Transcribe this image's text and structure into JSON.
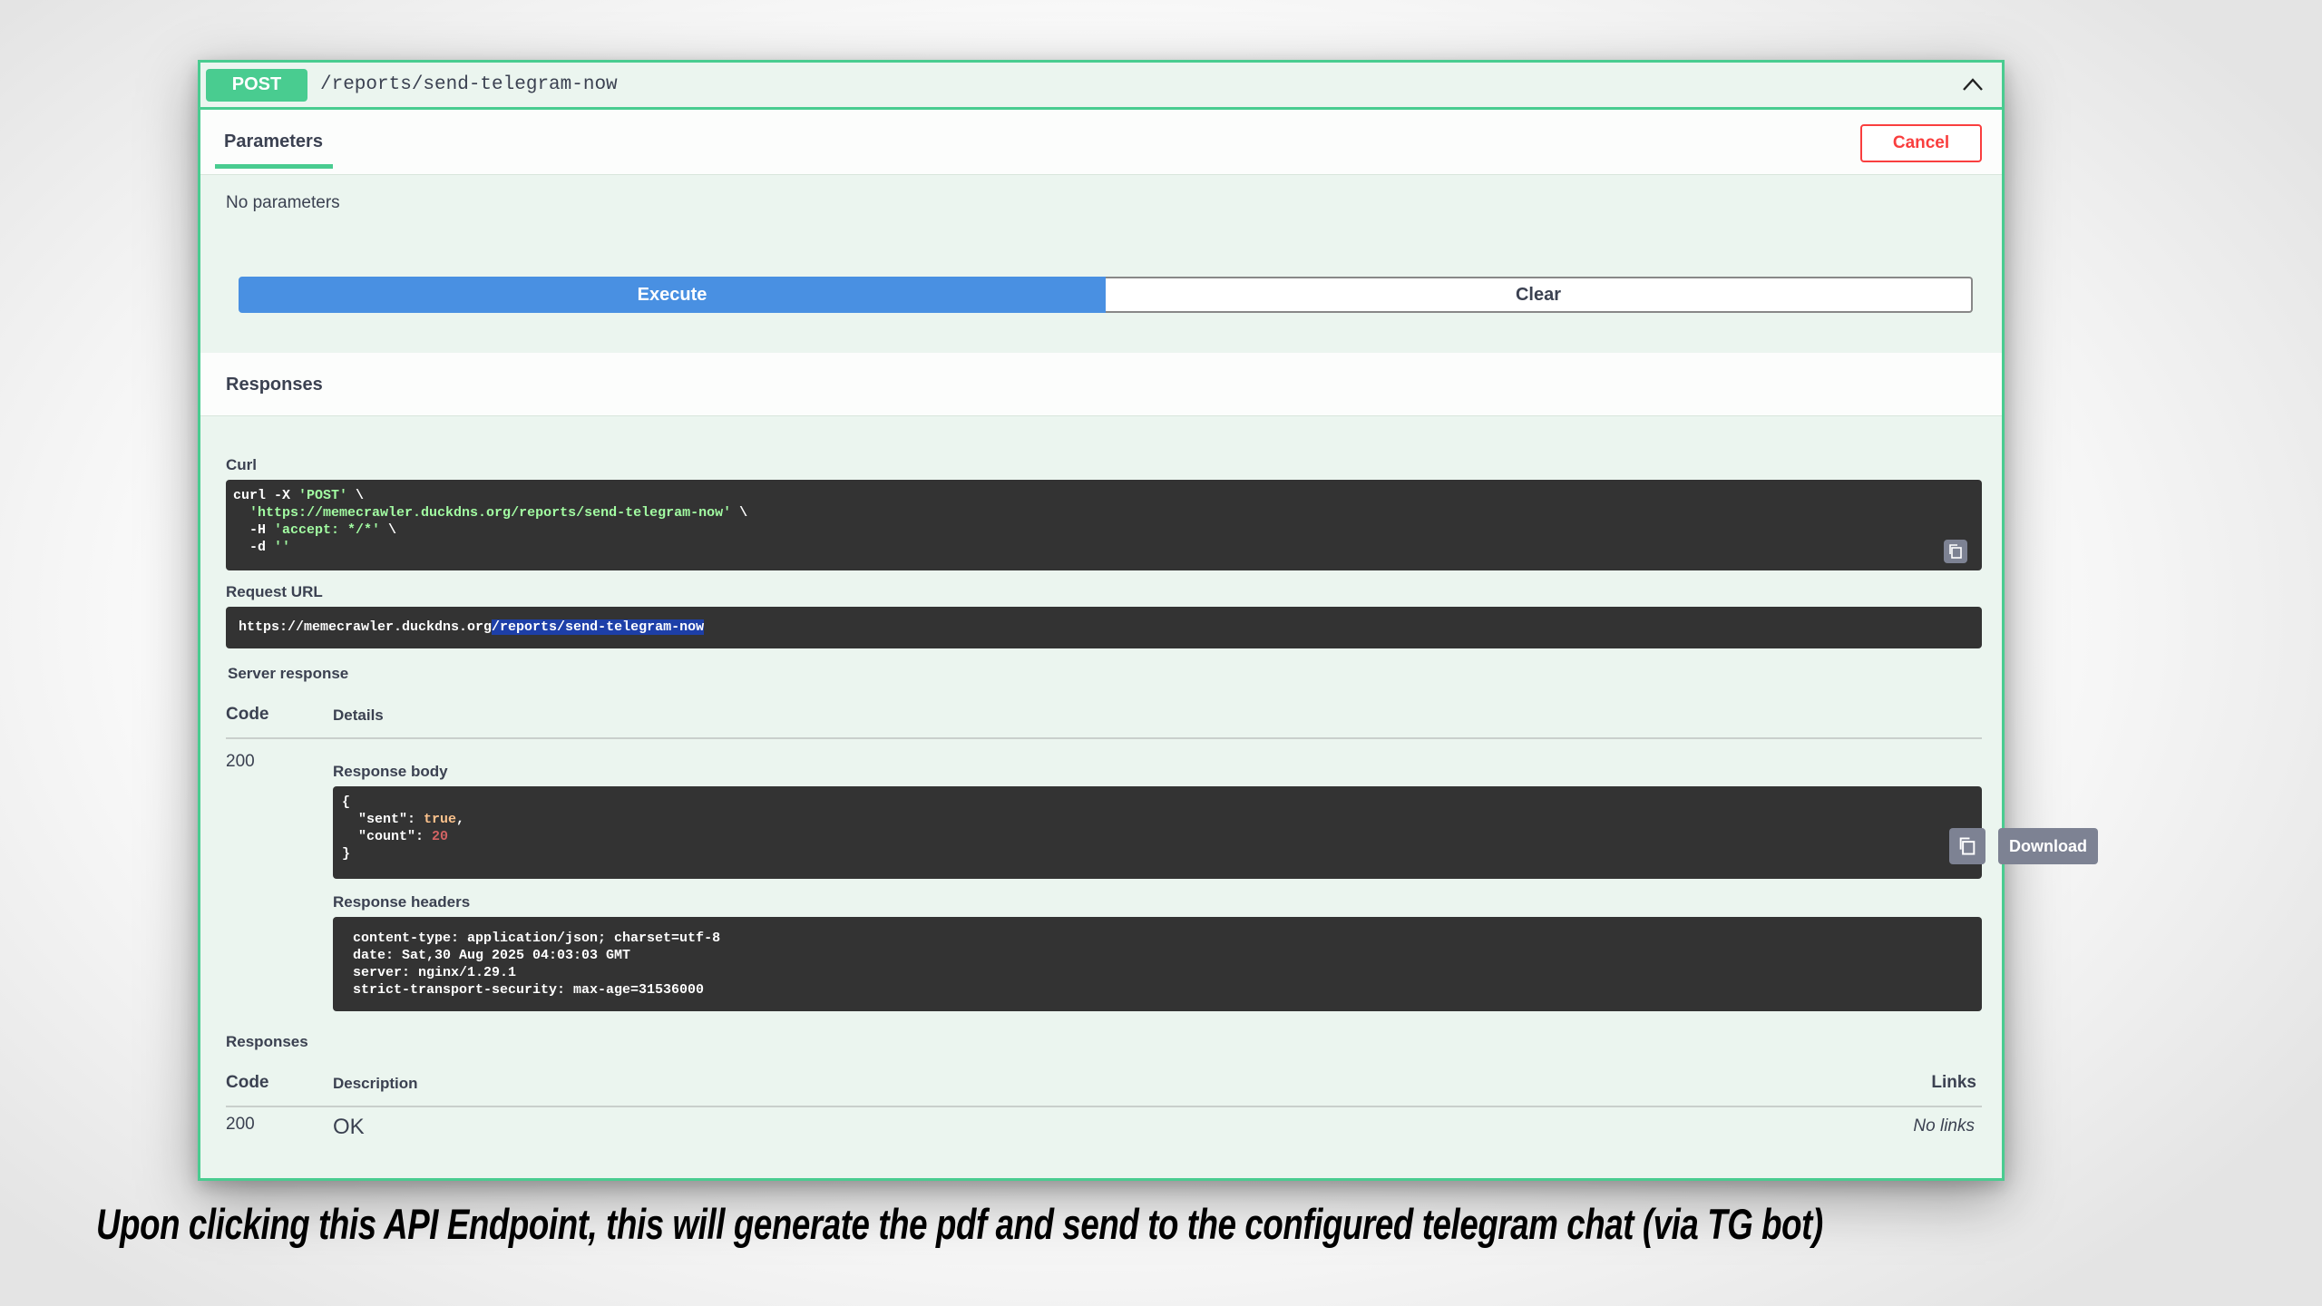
{
  "operation": {
    "method": "POST",
    "path": "/reports/send-telegram-now"
  },
  "tabs": {
    "parameters_label": "Parameters",
    "cancel_label": "Cancel"
  },
  "parameters": {
    "empty_text": "No parameters"
  },
  "actions": {
    "execute_label": "Execute",
    "clear_label": "Clear"
  },
  "responses_section": {
    "title": "Responses",
    "curl_label": "Curl",
    "curl_lines": {
      "l1_cmd": "curl -X ",
      "l1_str": "'POST'",
      "l1_tail": " \\",
      "l2_indent": "  ",
      "l2_str": "'https://memecrawler.duckdns.org/reports/send-telegram-now'",
      "l2_tail": " \\",
      "l3_cmd": "  -H ",
      "l3_str": "'accept: */*'",
      "l3_tail": " \\",
      "l4_cmd": "  -d ",
      "l4_str": "''"
    },
    "request_url_label": "Request URL",
    "request_url_host": "https://memecrawler.duckdns.org",
    "request_url_path": "/reports/send-telegram-now",
    "server_response_label": "Server response",
    "code_header": "Code",
    "details_header": "Details",
    "response_code": "200",
    "response_body_label": "Response body",
    "body_lines": {
      "open": "{",
      "sent_key": "  \"sent\": ",
      "sent_val": "true",
      "sent_comma": ",",
      "count_key": "  \"count\": ",
      "count_val": "20",
      "close": "}"
    },
    "download_label": "Download",
    "response_headers_label": "Response headers",
    "headers_lines": [
      "content-type: application/json; charset=utf-8",
      "date: Sat,30 Aug 2025 04:03:03 GMT",
      "server: nginx/1.29.1",
      "strict-transport-security: max-age=31536000"
    ]
  },
  "documented_responses": {
    "title": "Responses",
    "code_header": "Code",
    "description_header": "Description",
    "links_header": "Links",
    "rows": [
      {
        "code": "200",
        "description": "OK",
        "links": "No links"
      }
    ]
  },
  "caption": "Upon clicking this API Endpoint, this will generate the pdf and send to the configured telegram chat (via TG bot)",
  "colors": {
    "post_green": "#49cc90",
    "panel_bg": "#ebf5ef",
    "execute_blue": "#4990e2",
    "cancel_red": "#f93e3e",
    "code_bg": "#333333"
  }
}
